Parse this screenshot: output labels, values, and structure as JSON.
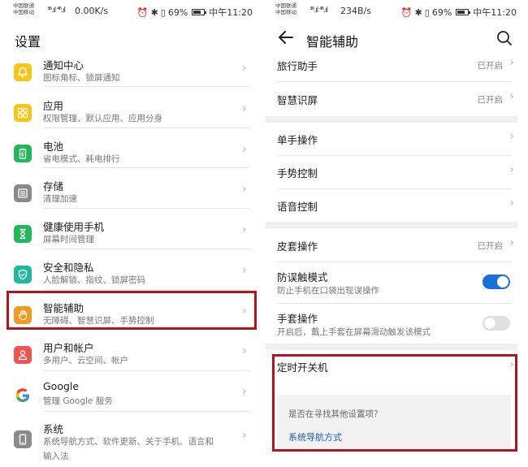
{
  "left": {
    "status": {
      "carrier_top": "中国联通",
      "carrier_bottom": "中国移动",
      "signal": "³⁶.ıl ⁴⁶.ıl",
      "speed": "0.00K/s",
      "battery": "69%",
      "time": "中午11:20"
    },
    "title": "设置",
    "items": [
      {
        "title": "通知中心",
        "sub": "图标角标、锁屏通知",
        "icon": "bell-icon",
        "color": "#f5c518"
      },
      {
        "title": "应用",
        "sub": "权限管理、默认应用、应用分身",
        "icon": "apps-grid-icon",
        "color": "#f5c518"
      },
      {
        "title": "电池",
        "sub": "省电模式、耗电排行",
        "icon": "battery-icon",
        "color": "#22b85a"
      },
      {
        "title": "存储",
        "sub": "清理加速",
        "icon": "storage-icon",
        "color": "#8a8a8a"
      },
      {
        "title": "健康使用手机",
        "sub": "屏幕时间管理",
        "icon": "hourglass-icon",
        "color": "#22b85a"
      },
      {
        "title": "安全和隐私",
        "sub": "人脸解锁、指纹、锁屏密码",
        "icon": "shield-icon",
        "color": "#1fb8a0"
      },
      {
        "title": "智能辅助",
        "sub": "无障碍、智慧识屏、手势控制",
        "icon": "hand-icon",
        "color": "#f39a1e"
      },
      {
        "title": "用户和帐户",
        "sub": "多用户、云空间、帐户",
        "icon": "user-icon",
        "color": "#ef5350"
      },
      {
        "title": "Google",
        "sub": "管理 Google 服务",
        "icon": "google-icon",
        "color": "#ffffff"
      },
      {
        "title": "系统",
        "sub": "系统导航方式、软件更新、关于手机、语言和",
        "sub2": "输入法",
        "icon": "phone-icon",
        "color": "#8a8a8a"
      }
    ]
  },
  "right": {
    "status": {
      "carrier_top": "中国联通",
      "carrier_bottom": "中国移动",
      "signal": "³⁶.ıl ⁴⁶.ıl",
      "speed": "234B/s",
      "battery": "69%",
      "time": "中午11:20"
    },
    "title": "智能辅助",
    "group1": [
      {
        "title": "旅行助手",
        "status": "已开启"
      },
      {
        "title": "智慧识屏",
        "status": "已开启"
      }
    ],
    "group2": [
      {
        "title": "单手操作"
      },
      {
        "title": "手势控制"
      },
      {
        "title": "语音控制"
      }
    ],
    "group3": [
      {
        "title": "皮套操作",
        "status": "已开启"
      },
      {
        "title": "防误触模式",
        "sub": "防止手机在口袋出现误操作",
        "toggle": true
      },
      {
        "title": "手套操作",
        "sub": "开启后，戴上手套在屏幕滑动触发该模式",
        "toggle": false
      }
    ],
    "group4": [
      {
        "title": "定时开关机"
      }
    ],
    "hint": {
      "question": "是否在寻找其他设置项？",
      "link": "系统导航方式"
    }
  },
  "colors": {
    "accent": "#1b6fdb",
    "highlight": "#b3141e",
    "toggle_off": "#e0e0e0"
  }
}
